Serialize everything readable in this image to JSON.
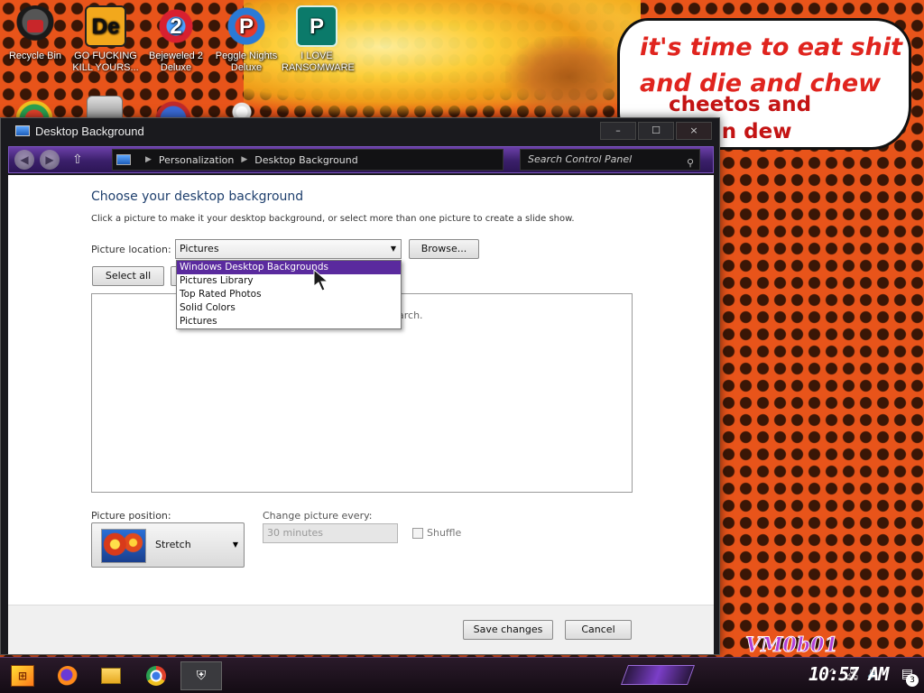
{
  "desktop": {
    "icons": [
      {
        "label": "Recycle Bin",
        "icon": "recycle-bin-icon"
      },
      {
        "label": "GO FUCKING KILL YOURS...",
        "icon": "dle-icon"
      },
      {
        "label": "Bejeweled 2 Deluxe",
        "icon": "bejeweled-icon"
      },
      {
        "label": "Peggle Nights Deluxe",
        "icon": "peggle-icon"
      },
      {
        "label": "I LOVE RANSOMWARE",
        "icon": "publisher-icon"
      }
    ],
    "icon_glyphs": {
      "dle": "De",
      "bejeweled": "2",
      "peggle": "P",
      "publisher": "P"
    },
    "bubble": {
      "line1": "it's time to eat shit",
      "line2": "and die and chew",
      "line3": "cheetos and",
      "line4": "ntain dew"
    },
    "watermark": "VM0b01"
  },
  "window": {
    "title": "Desktop Background",
    "controls": {
      "minimize": "–",
      "maximize": "☐",
      "close": "×"
    },
    "breadcrumb": [
      "Personalization",
      "Desktop Background"
    ],
    "search_placeholder": "Search Control Panel",
    "heading": "Choose your desktop background",
    "description": "Click a picture to make it your desktop background, or select more than one picture to create a slide show.",
    "picture_location_label": "Picture location:",
    "picture_location_value": "Pictures",
    "browse_label": "Browse...",
    "select_all_label": "Select all",
    "clear_all_label": "",
    "location_options": [
      "Windows Desktop Backgrounds",
      "Pictures Library",
      "Top Rated Photos",
      "Solid Colors",
      "Pictures"
    ],
    "highlighted_option": "Windows Desktop Backgrounds",
    "picture_area_text_fragment": "arch.",
    "picture_position_label": "Picture position:",
    "picture_position_value": "Stretch",
    "change_every_label": "Change picture every:",
    "change_every_value": "30 minutes",
    "shuffle_label": "Shuffle",
    "shuffle_checked": false,
    "save_label": "Save changes",
    "cancel_label": "Cancel"
  },
  "taskbar": {
    "clock": "10:57 AM",
    "notification_count": "3",
    "pinned": [
      "firefox-icon",
      "file-explorer-icon",
      "chrome-icon",
      "shield-icon"
    ]
  },
  "colors": {
    "dropdown_highlight": "#5a2a9e",
    "heading": "#1e3f6d",
    "bubble_text": "#e0241e"
  }
}
